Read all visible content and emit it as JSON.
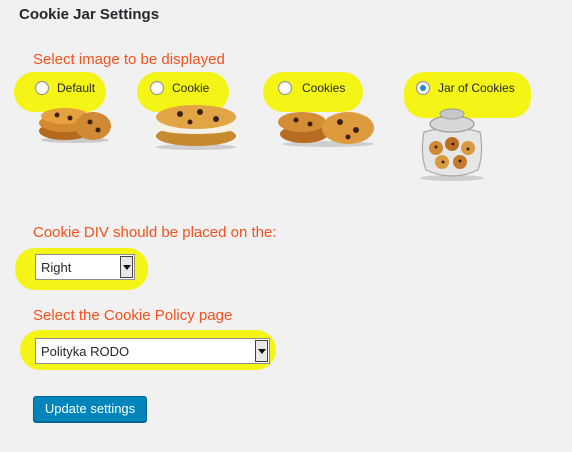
{
  "header": {
    "title": "Cookie Jar Settings"
  },
  "image_section": {
    "label": "Select image to be displayed",
    "options": [
      {
        "label": "Default",
        "checked": false,
        "icon": "cookie-stack-icon"
      },
      {
        "label": "Cookie",
        "checked": false,
        "icon": "cookie-sandwich-icon"
      },
      {
        "label": "Cookies",
        "checked": false,
        "icon": "cookies-pile-icon"
      },
      {
        "label": "Jar of Cookies",
        "checked": true,
        "icon": "cookie-jar-icon"
      }
    ]
  },
  "position_section": {
    "label": "Cookie DIV should be placed on the:",
    "selected": "Right"
  },
  "policy_section": {
    "label": "Select the Cookie Policy page",
    "selected": "Polityka RODO"
  },
  "actions": {
    "update_label": "Update settings"
  },
  "colors": {
    "highlight": "#f4f403",
    "section_label": "#f4511e",
    "button": "#0085ba",
    "background": "#f1f1f1"
  }
}
